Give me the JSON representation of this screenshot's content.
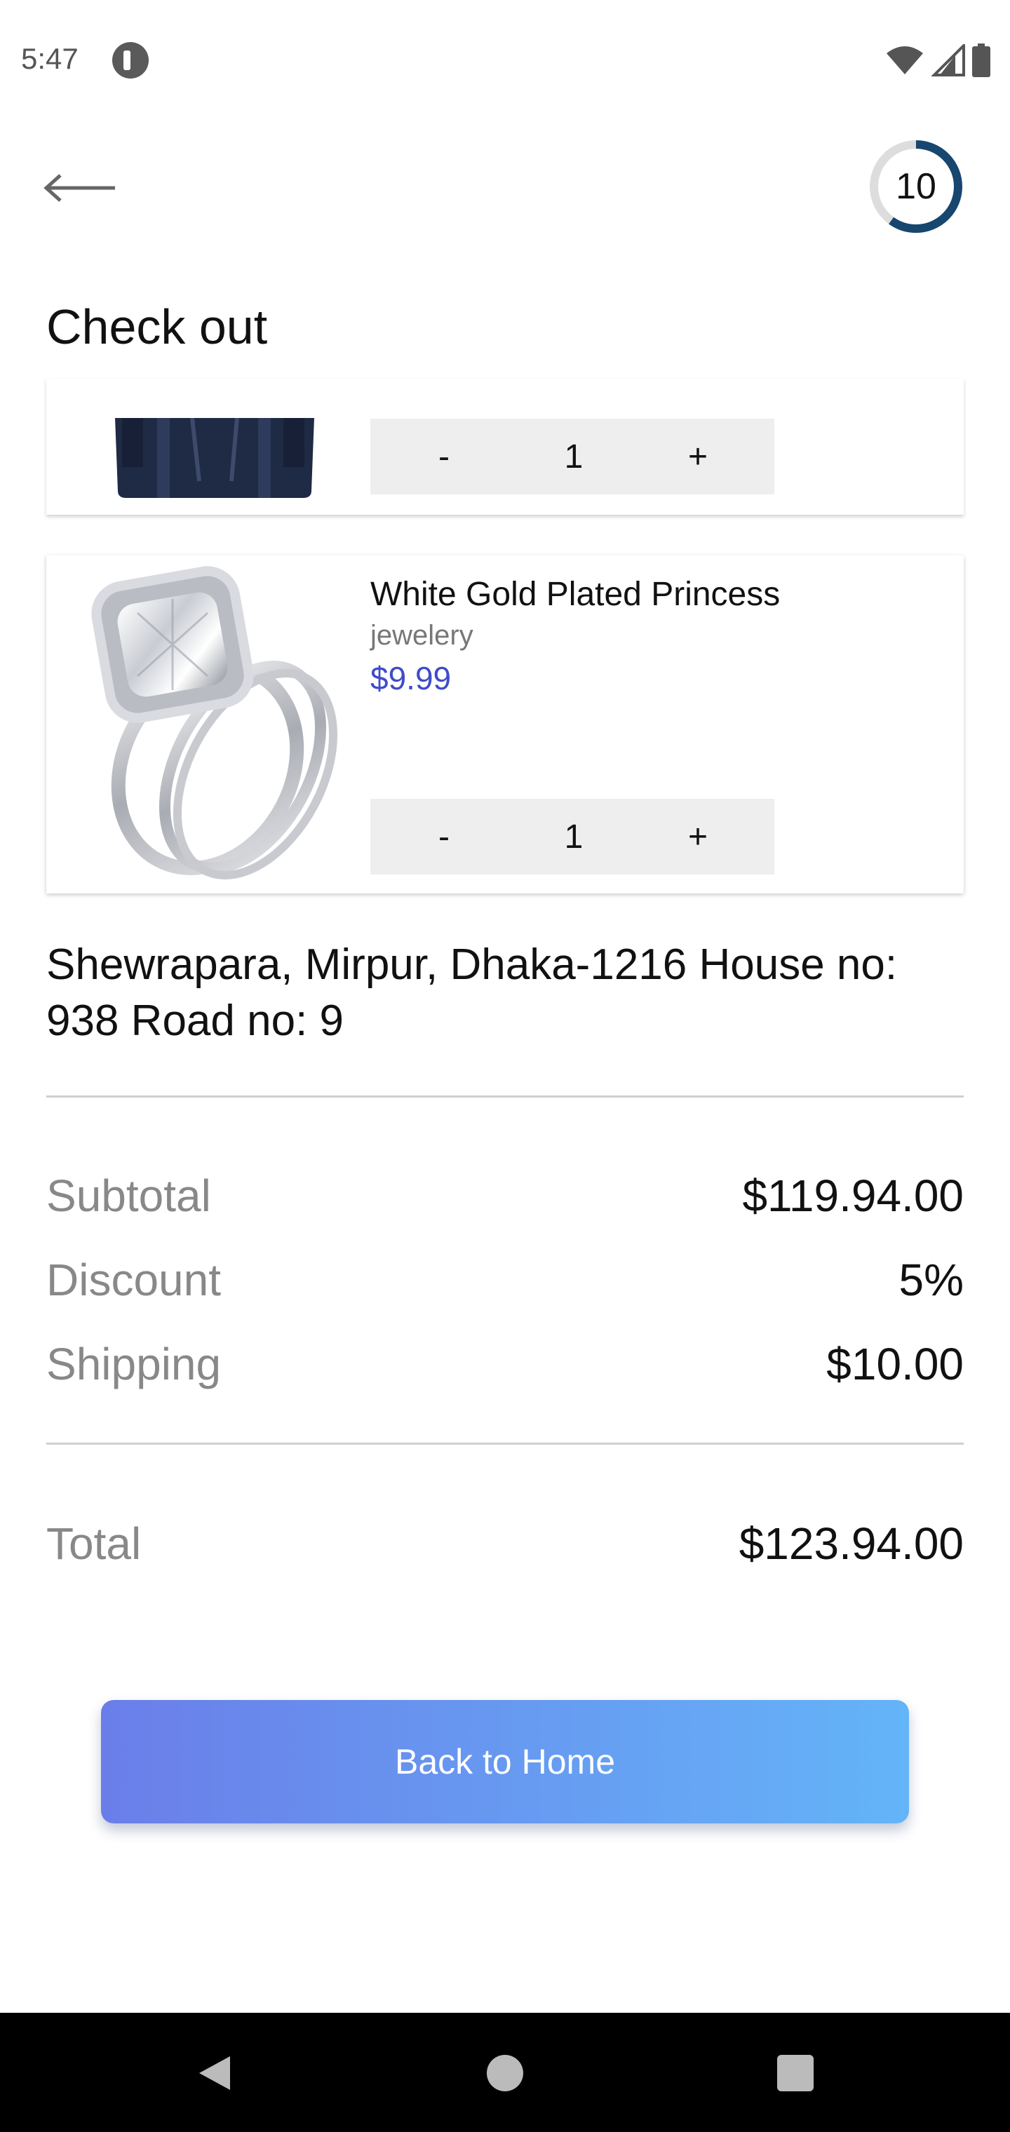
{
  "status_bar": {
    "time": "5:47",
    "icons": [
      "app-notification-icon",
      "wifi-icon",
      "signal-icon",
      "battery-icon"
    ]
  },
  "header": {
    "back_icon": "arrow-left-icon",
    "timer_value": "10",
    "timer_progress": 0.6,
    "timer_color": "#17466f"
  },
  "page_title": "Check out",
  "cart": {
    "items": [
      {
        "name": "",
        "image": "navy-bag-image",
        "quantity": "1",
        "minus_label": "-",
        "plus_label": "+"
      },
      {
        "name": "White Gold Plated Princess",
        "category": "jewelery",
        "price": "$9.99",
        "image": "diamond-ring-image",
        "quantity": "1",
        "minus_label": "-",
        "plus_label": "+"
      }
    ]
  },
  "address": "Shewrapara, Mirpur, Dhaka-1216 House no: 938 Road no: 9",
  "summary": {
    "subtotal_label": "Subtotal",
    "subtotal_value": "$119.94.00",
    "discount_label": "Discount",
    "discount_value": "5%",
    "shipping_label": "Shipping",
    "shipping_value": "$10.00",
    "total_label": "Total",
    "total_value": "$123.94.00"
  },
  "actions": {
    "back_home_label": "Back to Home"
  },
  "colors": {
    "price": "#3f4cc9",
    "button_gradient_start": "#6a7ee9",
    "button_gradient_end": "#64b4f8"
  },
  "nav_bar": {
    "icons": [
      "nav-back-icon",
      "nav-home-icon",
      "nav-recents-icon"
    ]
  }
}
